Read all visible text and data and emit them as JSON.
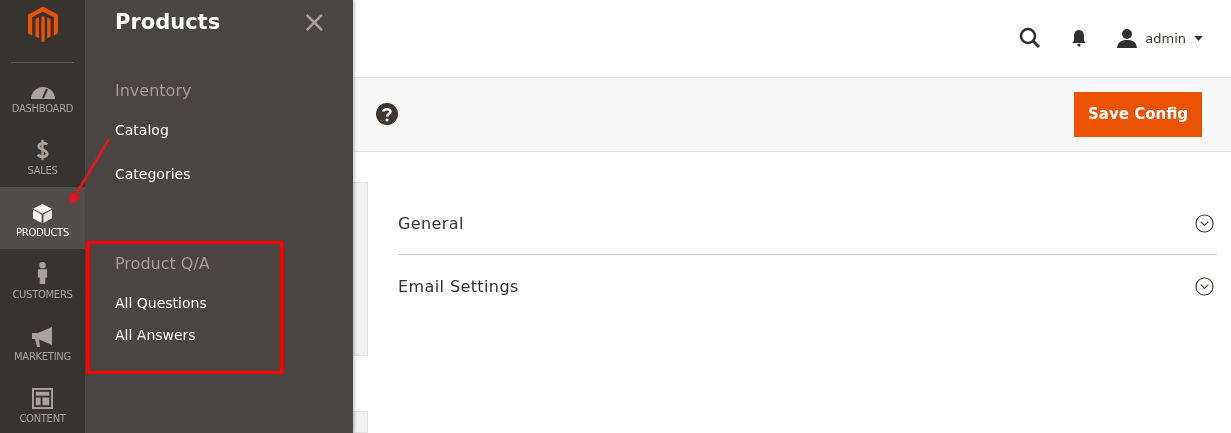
{
  "nav": {
    "items": [
      {
        "label": "DASHBOARD",
        "selected": false
      },
      {
        "label": "SALES",
        "selected": false
      },
      {
        "label": "PRODUCTS",
        "selected": true
      },
      {
        "label": "CUSTOMERS",
        "selected": false
      },
      {
        "label": "MARKETING",
        "selected": false
      },
      {
        "label": "CONTENT",
        "selected": false
      }
    ]
  },
  "annotations": [
    {
      "kind": "arrow"
    }
  ],
  "flyout": {
    "title": "Products",
    "close": "×",
    "sections": [
      {
        "title": "Inventory",
        "highlighted": false,
        "items": [
          "Catalog",
          "Categories"
        ]
      },
      {
        "title": "Product Q/A",
        "highlighted": true,
        "items": [
          "All Questions",
          "All Answers"
        ]
      }
    ]
  },
  "header": {
    "user": "admin"
  },
  "actions": {
    "save_button": "Save Config"
  },
  "config_sections": [
    {
      "title": "General",
      "expanded": false
    },
    {
      "title": "Email Settings",
      "expanded": false
    }
  ]
}
